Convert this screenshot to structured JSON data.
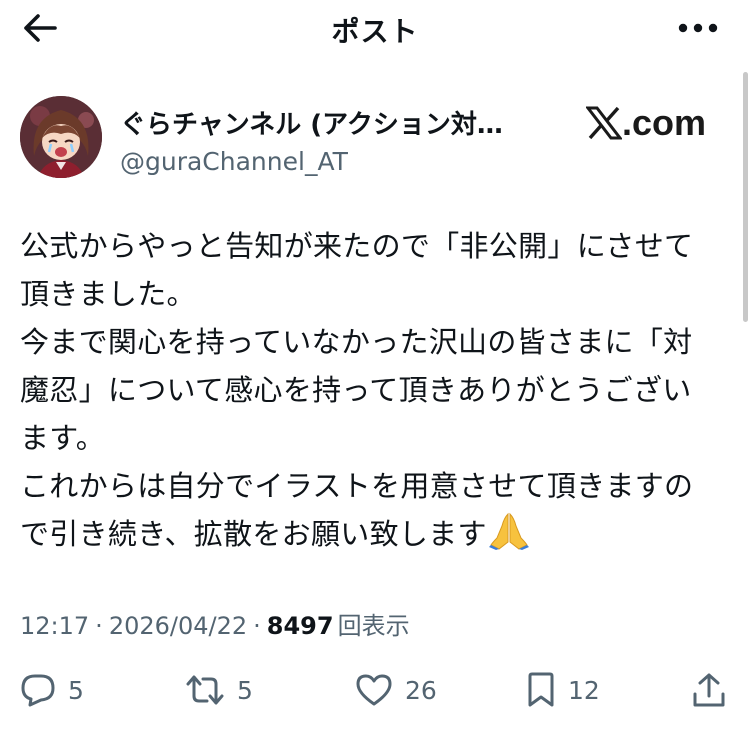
{
  "header": {
    "title": "ポスト"
  },
  "author": {
    "display_name": "ぐらチャンネル (アクション対…",
    "handle": "@guraChannel_AT",
    "source_label": ".com"
  },
  "post": {
    "paragraphs": [
      "公式からやっと告知が来たので「非公開」にさせて頂きました。",
      "今まで関心を持っていなかった沢山の皆さまに「対魔忍」について感心を持って頂きありがとうございます。",
      "これからは自分でイラストを用意させて頂きますので引き続き、拡散をお願い致します"
    ],
    "trailing_emoji": "folded-hands"
  },
  "meta": {
    "time": "12:17",
    "separator": "·",
    "date": "2026/04/22",
    "views_count": "8497",
    "views_label": "回表示"
  },
  "actions": {
    "replies": "5",
    "reposts": "5",
    "likes": "26",
    "bookmarks": "12"
  },
  "icons": {
    "back": "arrow-left-icon",
    "more": "more-horizontal-icon",
    "reply": "reply-icon",
    "repost": "repost-icon",
    "like": "heart-icon",
    "bookmark": "bookmark-icon",
    "share": "share-icon"
  },
  "colors": {
    "text": "#0f1419",
    "secondary": "#536471"
  }
}
